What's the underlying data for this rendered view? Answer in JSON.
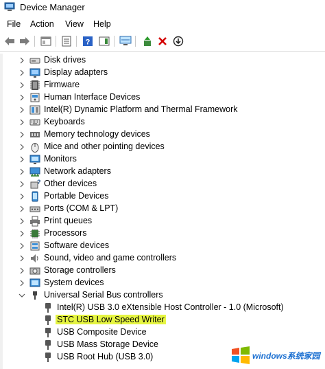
{
  "window": {
    "title": "Device Manager"
  },
  "menu": [
    {
      "label": "File"
    },
    {
      "label": "Action"
    },
    {
      "label": "View"
    },
    {
      "label": "Help"
    }
  ],
  "toolbar": [
    {
      "icon": "back-arrow-icon"
    },
    {
      "icon": "forward-arrow-icon"
    },
    {
      "icon": "properties-window-icon"
    },
    {
      "icon": "device-list-icon"
    },
    {
      "icon": "help-icon"
    },
    {
      "icon": "action-pane-icon"
    },
    {
      "icon": "monitor-scan-icon"
    },
    {
      "icon": "update-driver-icon"
    },
    {
      "icon": "uninstall-x-icon"
    },
    {
      "icon": "disable-device-icon"
    }
  ],
  "tree": {
    "categories": [
      {
        "label": "Disk drives",
        "icon": "disk-drive-icon",
        "expanded": false
      },
      {
        "label": "Display adapters",
        "icon": "display-adapter-icon",
        "expanded": false
      },
      {
        "label": "Firmware",
        "icon": "firmware-icon",
        "expanded": false
      },
      {
        "label": "Human Interface Devices",
        "icon": "hid-icon",
        "expanded": false
      },
      {
        "label": "Intel(R) Dynamic Platform and Thermal Framework",
        "icon": "intel-platform-icon",
        "expanded": false
      },
      {
        "label": "Keyboards",
        "icon": "keyboard-icon",
        "expanded": false
      },
      {
        "label": "Memory technology devices",
        "icon": "memory-icon",
        "expanded": false
      },
      {
        "label": "Mice and other pointing devices",
        "icon": "mouse-icon",
        "expanded": false
      },
      {
        "label": "Monitors",
        "icon": "monitor-icon",
        "expanded": false
      },
      {
        "label": "Network adapters",
        "icon": "network-adapter-icon",
        "expanded": false
      },
      {
        "label": "Other devices",
        "icon": "other-devices-icon",
        "expanded": false
      },
      {
        "label": "Portable Devices",
        "icon": "portable-device-icon",
        "expanded": false
      },
      {
        "label": "Ports (COM & LPT)",
        "icon": "port-icon",
        "expanded": false
      },
      {
        "label": "Print queues",
        "icon": "printer-icon",
        "expanded": false
      },
      {
        "label": "Processors",
        "icon": "processor-icon",
        "expanded": false
      },
      {
        "label": "Software devices",
        "icon": "software-device-icon",
        "expanded": false
      },
      {
        "label": "Sound, video and game controllers",
        "icon": "speaker-icon",
        "expanded": false
      },
      {
        "label": "Storage controllers",
        "icon": "storage-controller-icon",
        "expanded": false
      },
      {
        "label": "System devices",
        "icon": "system-device-icon",
        "expanded": false
      },
      {
        "label": "Universal Serial Bus controllers",
        "icon": "usb-icon",
        "expanded": true
      }
    ],
    "usb_children": [
      {
        "label": "Intel(R) USB 3.0 eXtensible Host Controller - 1.0 (Microsoft)",
        "highlighted": false
      },
      {
        "label": "STC USB Low Speed Writer",
        "highlighted": true
      },
      {
        "label": "USB Composite Device",
        "highlighted": false
      },
      {
        "label": "USB Mass Storage Device",
        "highlighted": false
      },
      {
        "label": "USB Root Hub (USB 3.0)",
        "highlighted": false
      }
    ]
  },
  "watermark": {
    "text": "windows系统家园",
    "icon": "windows-logo-icon"
  },
  "colors": {
    "highlight": "#e6f542",
    "accent": "#1a6fd1"
  }
}
